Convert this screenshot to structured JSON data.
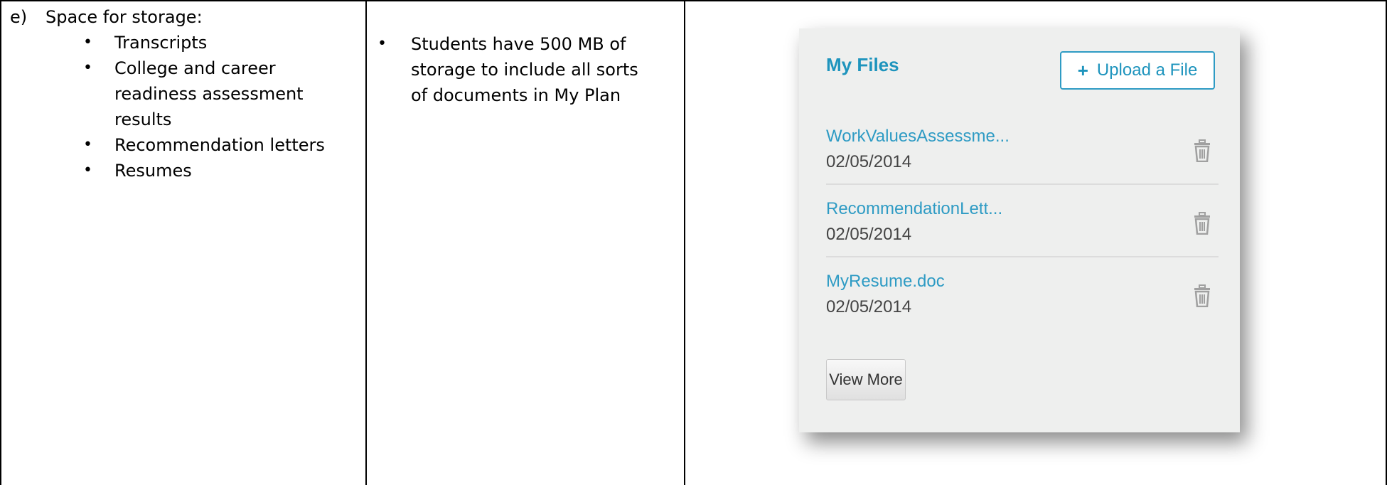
{
  "row": {
    "marker": "e)",
    "heading": "Space for storage:",
    "bullets": [
      "Transcripts",
      "College and career readiness assessment results",
      "Recommendation letters",
      "Resumes"
    ],
    "description": "Students have 500 MB of storage to include all sorts of documents in My Plan"
  },
  "widget": {
    "title": "My Files",
    "upload_label": "Upload a File",
    "upload_icon": "plus-icon",
    "files": [
      {
        "name": "WorkValuesAssessme...",
        "date": "02/05/2014",
        "icon": "trash-icon"
      },
      {
        "name": "RecommendationLett...",
        "date": "02/05/2014",
        "icon": "trash-icon"
      },
      {
        "name": "MyResume.doc",
        "date": "02/05/2014",
        "icon": "trash-icon"
      }
    ],
    "view_more_label": "View More",
    "colors": {
      "accent": "#1e94bd",
      "panel_bg": "#eeefee",
      "icon_gray": "#a0a0a0"
    }
  }
}
